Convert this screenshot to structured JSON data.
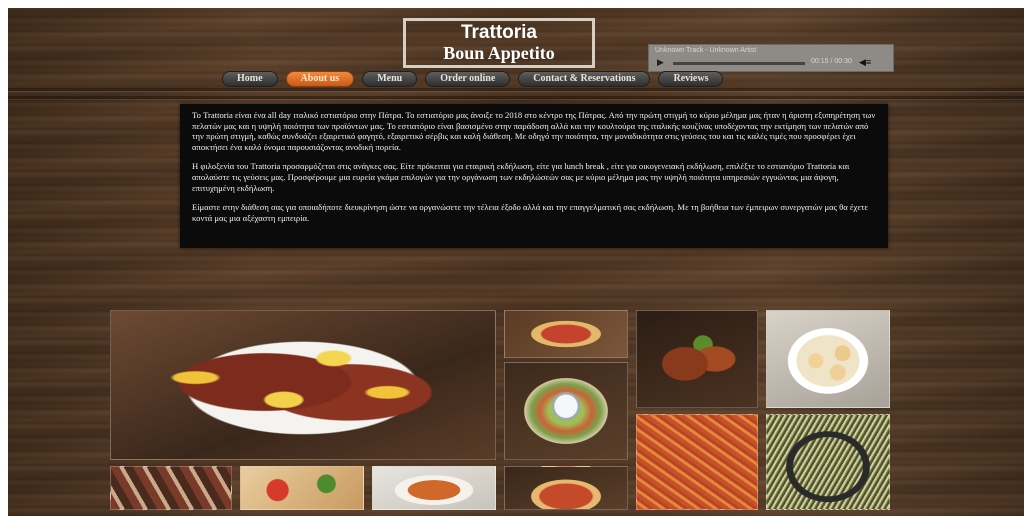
{
  "logo": {
    "line1": "Trattoria",
    "line2": "Boun Appetito"
  },
  "player": {
    "track": "Unknown Track - Unknown Artist",
    "time": "00:15 / 00:30",
    "progress": 0.0
  },
  "nav": {
    "items": [
      {
        "label": "Home",
        "active": false
      },
      {
        "label": "About us",
        "active": true
      },
      {
        "label": "Menu",
        "active": false
      },
      {
        "label": "Order online",
        "active": false
      },
      {
        "label": "Contact & Reservations",
        "active": false
      },
      {
        "label": "Reviews",
        "active": false
      }
    ]
  },
  "about": {
    "p1": "Το Trattoria είναι ένα all day ιταλικό εστιατόριο στην Πάτρα. Το εστιατόριο μας άνοιξε το 2018 στο κέντρο της Πάτρας. Από την πρώτη στιγμή το κύριο μέλημα μας ήταν η άριστη εξυπηρέτηση των πελατών μας και η υψηλή ποιότητα των προϊόντων μας. Το εστιατόριο είναι βασισμένο στην παράδοση αλλά και την κουλτούρα της ιταλικής κουζίνας υποδέχοντας την εκτίμηση των πελατών από την πρώτη στιγμή, καθώς συνδυάζει εξαιρετικό φαγητό, εξαιρετικό σέρβις και καλή διάθεση. Με οδηγό την ποιότητα, την μοναδικότητα στις γεύσεις του και τις καλές τιμές που προσφέρει έχει αποκτήσει ένα καλό όνομα παρουσιάζοντας ανοδική πορεία.",
    "p2": "Η φιλοξενία του Trattoria προσαρμόζεται στις ανάγκες σας. Είτε πρόκειται για εταιρική εκδήλωση, είτε για lunch break , είτε για οικογενειακή εκδήλωση, επιλέξτε το εστιατόριο Trattoria και απολαύστε τις γεύσεις μας. Προσφέρουμε μια ευρεία γκάμα επιλογών για την οργάνωση των εκδηλώσεών σας με κύριο μέλημα μας την υψηλή ποιότητα υπηρεσιών εγγυώντας μια άψογη, επιτυχημένη εκδήλωση.",
    "p3": "Είμαστε στην διάθεση σας για οποιαδήποτε διευκρίνηση ώστε να οργανώσετε την τέλεια έξοδο αλλά και την επαγγελματική σας εκδήλωση. Με τη βοήθεια των έμπειρων συνεργατών μας θα έχετε κοντά μας μια αξέχαστη εμπειρία."
  },
  "gallery": {
    "tiles": [
      "grilled-octopus",
      "pizza",
      "salad",
      "grilled-chicken",
      "scallops",
      "penne-pasta",
      "spaghetti",
      "cured-meat",
      "bruschetta-pizza",
      "spaghetti-plate",
      "pizza-slice"
    ]
  }
}
